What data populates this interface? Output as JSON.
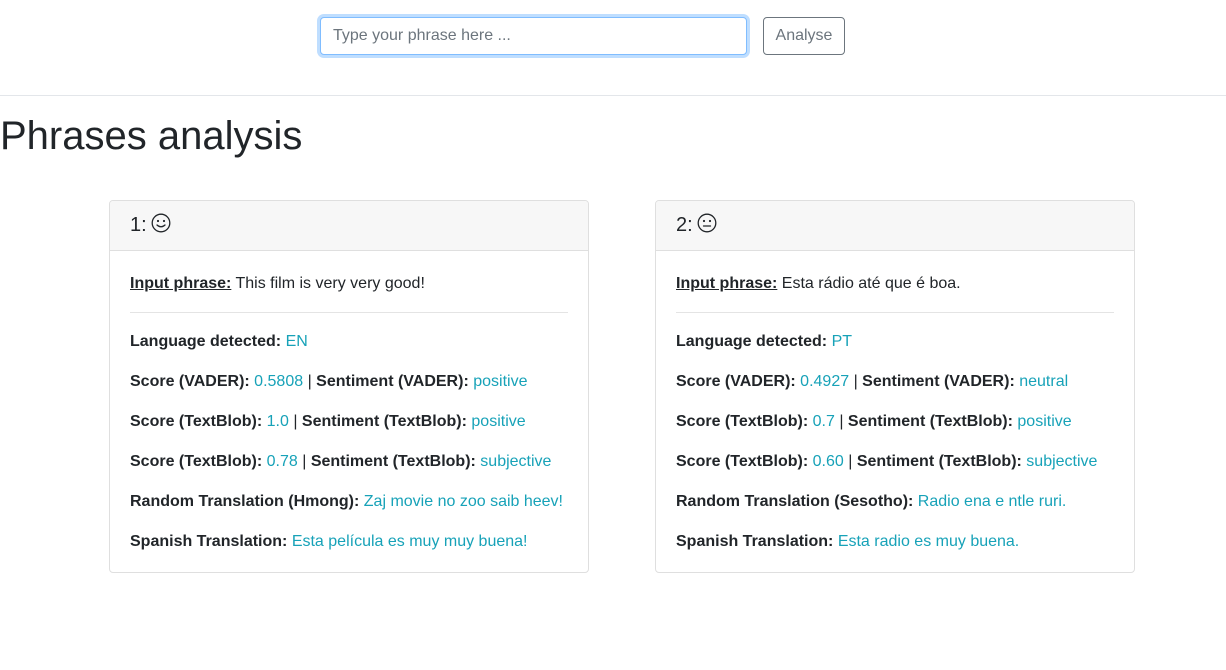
{
  "search": {
    "placeholder": "Type your phrase here ...",
    "value": "",
    "button_label": "Analyse"
  },
  "page_title": "Phrases analysis",
  "colors": {
    "accent": "#17a2b8",
    "focus_border": "#80bdff"
  },
  "cards": [
    {
      "number": "1:",
      "face_icon": "smiley-face-icon",
      "input_label": "Input phrase:",
      "input_phrase": "This film is very very good!",
      "language_label": "Language detected:",
      "language": "EN",
      "vader_score_label": "Score (VADER):",
      "vader_score": "0.5808",
      "sep": "|",
      "vader_sentiment_label": "Sentiment (VADER):",
      "vader_sentiment": "positive",
      "tb_score_label": "Score (TextBlob):",
      "tb_score": "1.0",
      "tb_sentiment_label": "Sentiment (TextBlob):",
      "tb_sentiment": "positive",
      "tb_score2_label": "Score (TextBlob):",
      "tb_score2": "0.78",
      "tb_sentiment2_label": "Sentiment (TextBlob):",
      "tb_sentiment2": "subjective",
      "random_translation_label": "Random Translation (Hmong):",
      "random_translation": "Zaj movie no zoo saib heev!",
      "spanish_translation_label": "Spanish Translation:",
      "spanish_translation": "Esta película es muy muy buena!"
    },
    {
      "number": "2:",
      "face_icon": "neutral-face-icon",
      "input_label": "Input phrase:",
      "input_phrase": "Esta rádio até que é boa.",
      "language_label": "Language detected:",
      "language": "PT",
      "vader_score_label": "Score (VADER):",
      "vader_score": "0.4927",
      "sep": "|",
      "vader_sentiment_label": "Sentiment (VADER):",
      "vader_sentiment": "neutral",
      "tb_score_label": "Score (TextBlob):",
      "tb_score": "0.7",
      "tb_sentiment_label": "Sentiment (TextBlob):",
      "tb_sentiment": "positive",
      "tb_score2_label": "Score (TextBlob):",
      "tb_score2": "0.60",
      "tb_sentiment2_label": "Sentiment (TextBlob):",
      "tb_sentiment2": "subjective",
      "random_translation_label": "Random Translation (Sesotho):",
      "random_translation": "Radio ena e ntle ruri.",
      "spanish_translation_label": "Spanish Translation:",
      "spanish_translation": "Esta radio es muy buena."
    }
  ]
}
